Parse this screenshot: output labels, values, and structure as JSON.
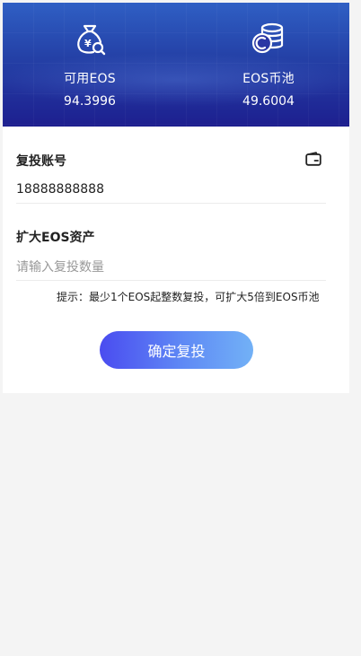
{
  "header": {
    "available": {
      "label": "可用EOS",
      "value": "94.3996",
      "icon": "money-bag-search-icon"
    },
    "pool": {
      "label": "EOS币池",
      "value": "49.6004",
      "icon": "coin-stack-icon"
    },
    "colors": {
      "top": "#2f5fc4",
      "bottom": "#1d1f8f"
    }
  },
  "form": {
    "account": {
      "title": "复投账号",
      "value": "18888888888",
      "icon": "wallet-icon"
    },
    "amount": {
      "title": "扩大EOS资产",
      "placeholder": "请输入复投数量",
      "value": ""
    },
    "hint": "提示：最少1个EOS起整数复投，可扩大5倍到EOS币池",
    "confirm_label": "确定复投",
    "button_gradient": [
      "#4a4cf0",
      "#72b1f6"
    ]
  }
}
